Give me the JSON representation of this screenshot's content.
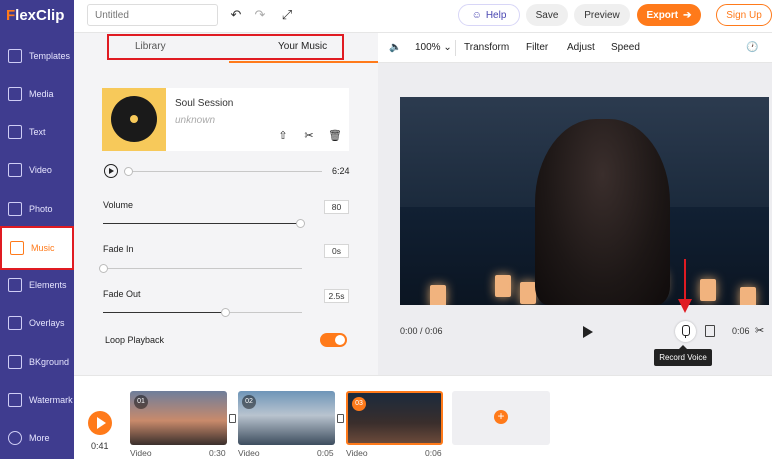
{
  "app": {
    "logo": "FlexClip",
    "logo_accent": "#ff7a1a"
  },
  "header": {
    "title_placeholder": "Untitled",
    "help_label": "Help",
    "save_label": "Save",
    "preview_label": "Preview",
    "export_label": "Export",
    "signup_label": "Sign Up",
    "undo_icon": "undo-icon",
    "redo_icon": "redo-icon",
    "fullscreen_icon": "fullscreen-icon"
  },
  "sidebar": {
    "items": [
      {
        "label": "Templates",
        "icon": "layers-icon"
      },
      {
        "label": "Media",
        "icon": "media-icon"
      },
      {
        "label": "Text",
        "icon": "text-icon"
      },
      {
        "label": "Video",
        "icon": "video-icon"
      },
      {
        "label": "Photo",
        "icon": "photo-icon"
      },
      {
        "label": "Music",
        "icon": "music-icon",
        "active": true
      },
      {
        "label": "Elements",
        "icon": "elements-icon"
      },
      {
        "label": "Overlays",
        "icon": "overlays-icon"
      },
      {
        "label": "BKground",
        "icon": "background-icon"
      },
      {
        "label": "Watermark",
        "icon": "watermark-icon"
      },
      {
        "label": "More",
        "icon": "more-icon"
      }
    ]
  },
  "music_panel": {
    "tabs": [
      {
        "label": "Library"
      },
      {
        "label": "Your Music",
        "active": true
      }
    ],
    "track": {
      "name": "Soul Session",
      "artist": "unknown",
      "duration": "6:24",
      "progress": 0
    },
    "volume": {
      "label": "Volume",
      "value": "80"
    },
    "fade_in": {
      "label": "Fade In",
      "value": "0s"
    },
    "fade_out": {
      "label": "Fade Out",
      "value": "2.5s"
    },
    "loop": {
      "label": "Loop Playback",
      "on": true
    }
  },
  "editor_toolbar": {
    "zoom": "100%",
    "items": [
      {
        "label": "Transform"
      },
      {
        "label": "Filter"
      },
      {
        "label": "Adjust"
      },
      {
        "label": "Speed"
      }
    ]
  },
  "player": {
    "time": "0:00 / 0:06",
    "duration_right": "0:06",
    "tooltip": "Record Voice"
  },
  "timeline": {
    "current_time": "0:41",
    "clips": [
      {
        "num": "01",
        "type": "Video",
        "duration": "0:30"
      },
      {
        "num": "02",
        "type": "Video",
        "duration": "0:05"
      },
      {
        "num": "03",
        "type": "Video",
        "duration": "0:06",
        "selected": true
      }
    ],
    "add_label": "+"
  }
}
